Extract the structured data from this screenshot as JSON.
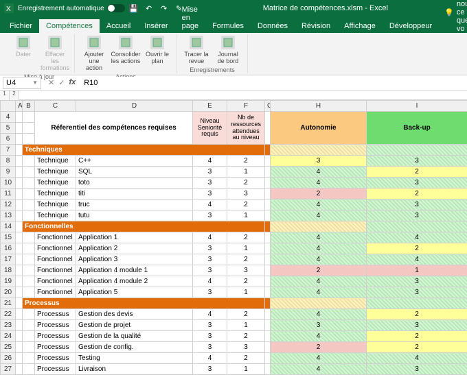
{
  "titlebar": {
    "autosave_label": "Enregistrement automatique",
    "doc_name": "Matrice de compétences.xlsm - Excel"
  },
  "tabs": {
    "items": [
      "Fichier",
      "Compétences",
      "Accueil",
      "Insérer",
      "Mise en page",
      "Formules",
      "Données",
      "Révision",
      "Affichage",
      "Développeur"
    ],
    "active_index": 1,
    "tell_me": "Dites-nous ce que vo"
  },
  "ribbon": {
    "groups": [
      {
        "label": "Mise à jour",
        "buttons": [
          "Dater",
          "Effacer les formations"
        ]
      },
      {
        "label": "Actions",
        "buttons": [
          "Ajouter une action",
          "Consolider les actions",
          "Ouvrir le plan"
        ]
      },
      {
        "label": "Enregistrements",
        "buttons": [
          "Tracer la revue",
          "Journal de bord"
        ]
      }
    ]
  },
  "namebox": {
    "ref": "U4"
  },
  "formula": {
    "value": "R10"
  },
  "columns": [
    "A",
    "B",
    "C",
    "D",
    "E",
    "F",
    "G",
    "H",
    "I"
  ],
  "header": {
    "referentiel": "Réferentiel des compétences requises",
    "niveau": "Niveau Seniorité requis",
    "nb": "Nb de ressources attendues au niveau",
    "autonomie": "Autonomie",
    "backup": "Back-up"
  },
  "sections": [
    {
      "row": 7,
      "title": "Techniques",
      "rows": [
        {
          "r": 8,
          "cat": "Technique",
          "name": "C++",
          "niv": 4,
          "nb": 2,
          "auto": "3",
          "aclass": "yellow",
          "back": "3",
          "bclass": "green-h"
        },
        {
          "r": 9,
          "cat": "Technique",
          "name": "SQL",
          "niv": 3,
          "nb": 1,
          "auto": "4",
          "aclass": "green-h",
          "back": "2",
          "bclass": "yellow"
        },
        {
          "r": 10,
          "cat": "Technique",
          "name": "toto",
          "niv": 3,
          "nb": 2,
          "auto": "4",
          "aclass": "green-h",
          "back": "3",
          "bclass": "green-h"
        },
        {
          "r": 11,
          "cat": "Technique",
          "name": "titi",
          "niv": 3,
          "nb": 3,
          "auto": "2",
          "aclass": "pink",
          "back": "2",
          "bclass": "yellow"
        },
        {
          "r": 12,
          "cat": "Technique",
          "name": "truc",
          "niv": 4,
          "nb": 2,
          "auto": "4",
          "aclass": "green-h",
          "back": "3",
          "bclass": "green-h"
        },
        {
          "r": 13,
          "cat": "Technique",
          "name": "tutu",
          "niv": 3,
          "nb": 1,
          "auto": "4",
          "aclass": "green-h",
          "back": "3",
          "bclass": "green-h"
        }
      ]
    },
    {
      "row": 14,
      "title": "Fonctionnelles",
      "rows": [
        {
          "r": 15,
          "cat": "Fonctionnel",
          "name": "Application 1",
          "niv": 4,
          "nb": 2,
          "auto": "4",
          "aclass": "green-h",
          "back": "4",
          "bclass": "green-h"
        },
        {
          "r": 16,
          "cat": "Fonctionnel",
          "name": "Application 2",
          "niv": 3,
          "nb": 1,
          "auto": "4",
          "aclass": "green-h",
          "back": "2",
          "bclass": "yellow"
        },
        {
          "r": 17,
          "cat": "Fonctionnel",
          "name": "Application 3",
          "niv": 3,
          "nb": 2,
          "auto": "4",
          "aclass": "green-h",
          "back": "4",
          "bclass": "green-h"
        },
        {
          "r": 18,
          "cat": "Fonctionnel",
          "name": "Application 4 module 1",
          "niv": 3,
          "nb": 3,
          "auto": "2",
          "aclass": "pink",
          "back": "1",
          "bclass": "pink"
        },
        {
          "r": 19,
          "cat": "Fonctionnel",
          "name": "Application 4 module 2",
          "niv": 4,
          "nb": 2,
          "auto": "4",
          "aclass": "green-h",
          "back": "3",
          "bclass": "green-h"
        },
        {
          "r": 20,
          "cat": "Fonctionnel",
          "name": "Application 5",
          "niv": 3,
          "nb": 1,
          "auto": "4",
          "aclass": "green-h",
          "back": "3",
          "bclass": "green-h"
        }
      ]
    },
    {
      "row": 21,
      "title": "Processus",
      "rows": [
        {
          "r": 22,
          "cat": "Processus",
          "name": "Gestion des devis",
          "niv": 4,
          "nb": 2,
          "auto": "4",
          "aclass": "green-h",
          "back": "2",
          "bclass": "yellow"
        },
        {
          "r": 23,
          "cat": "Processus",
          "name": "Gestion de projet",
          "niv": 3,
          "nb": 1,
          "auto": "3",
          "aclass": "green-h",
          "back": "3",
          "bclass": "green-h"
        },
        {
          "r": 24,
          "cat": "Processus",
          "name": "Gestion de la qualité",
          "niv": 3,
          "nb": 2,
          "auto": "4",
          "aclass": "green-h",
          "back": "2",
          "bclass": "yellow"
        },
        {
          "r": 25,
          "cat": "Processus",
          "name": "Gestion de config.",
          "niv": 3,
          "nb": 3,
          "auto": "2",
          "aclass": "pink",
          "back": "2",
          "bclass": "yellow"
        },
        {
          "r": 26,
          "cat": "Processus",
          "name": "Testing",
          "niv": 4,
          "nb": 2,
          "auto": "4",
          "aclass": "green-h",
          "back": "4",
          "bclass": "green-h"
        },
        {
          "r": 27,
          "cat": "Processus",
          "name": "Livraison",
          "niv": 3,
          "nb": 1,
          "auto": "4",
          "aclass": "green-h",
          "back": "3",
          "bclass": "green-h"
        }
      ]
    }
  ]
}
